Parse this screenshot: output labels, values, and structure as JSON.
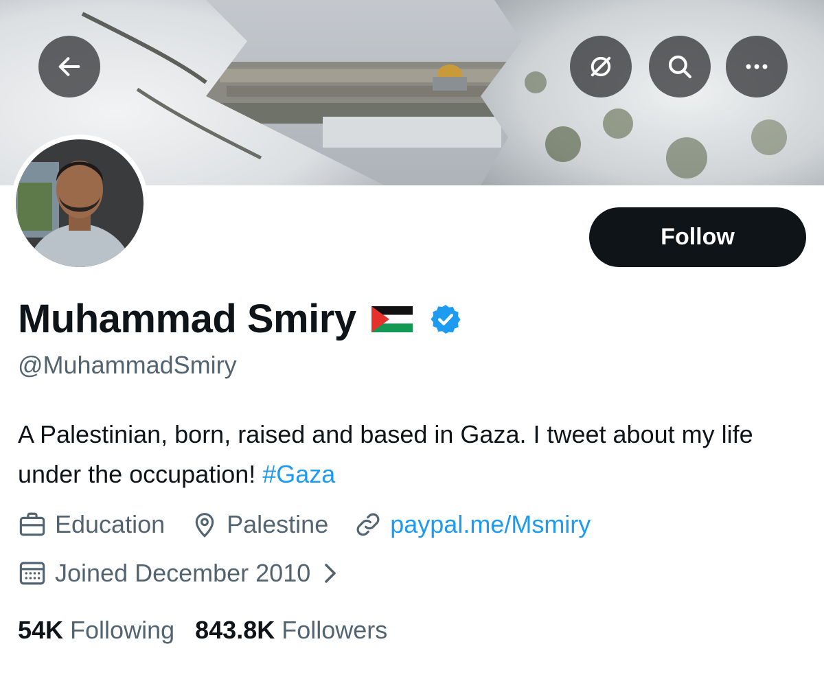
{
  "header": {
    "back_icon": "arrow-left-icon",
    "grok_icon": "grok-icon",
    "search_icon": "search-icon",
    "more_icon": "more-horizontal-icon"
  },
  "follow_button": {
    "label": "Follow"
  },
  "profile": {
    "display_name": "Muhammad Smiry",
    "flag_icon": "palestine-flag-icon",
    "verified_icon": "verified-badge-icon",
    "handle": "@MuhammadSmiry",
    "bio_text": "A Palestinian, born, raised and based in Gaza. I tweet about my life under the occupation! ",
    "bio_hashtag": "#Gaza",
    "category": "Education",
    "location": "Palestine",
    "website": "paypal.me/Msmiry",
    "joined": "Joined December 2010"
  },
  "stats": {
    "following_count": "54K",
    "following_label": "Following",
    "followers_count": "843.8K",
    "followers_label": "Followers"
  },
  "colors": {
    "text": "#0f1419",
    "secondary": "#536471",
    "accent": "#1d9bf0",
    "button": "#0f1419"
  }
}
